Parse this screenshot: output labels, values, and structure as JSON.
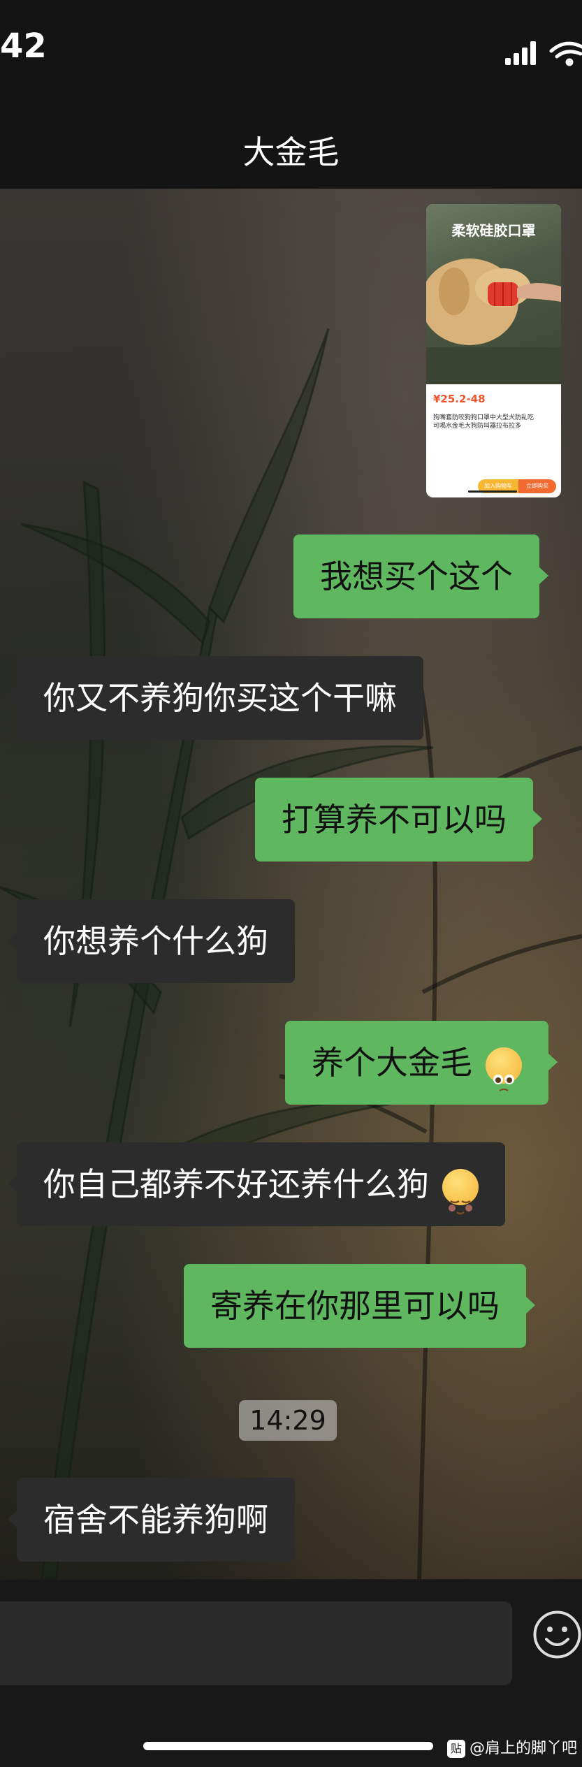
{
  "status_bar": {
    "time": "42"
  },
  "chat": {
    "title": "大金毛"
  },
  "product_card": {
    "headline": "柔软硅胶口罩",
    "price": "¥25.2-48",
    "description": "狗嘴套防咬狗狗口罩中大型犬防乱吃可喝水金毛大狗防叫器拉布拉多",
    "add_to_cart": "加入购物车",
    "buy_now": "立即购买"
  },
  "messages": [
    {
      "from": "me",
      "text": "我想买个这个"
    },
    {
      "from": "them",
      "text": "你又不养狗你买这个干嘛"
    },
    {
      "from": "me",
      "text": "打算养不可以吗"
    },
    {
      "from": "them",
      "text": "你想养个什么狗"
    },
    {
      "from": "me",
      "text": "养个大金毛",
      "emoji": "pleading-face-emoji"
    },
    {
      "from": "them",
      "text": "你自己都养不好还养什么狗",
      "emoji": "relieved-face-emoji"
    },
    {
      "from": "me",
      "text": "寄养在你那里可以吗"
    },
    {
      "from": "them",
      "text": "宿舍不能养狗啊"
    }
  ],
  "timestamp": "14:29",
  "watermark": {
    "badge": "贴",
    "text": "@肩上的脚丫吧"
  },
  "colors": {
    "my_bubble": "#5fb85f",
    "their_bubble": "#2c2c2c",
    "bar": "#141414",
    "price": "#f2542d"
  }
}
